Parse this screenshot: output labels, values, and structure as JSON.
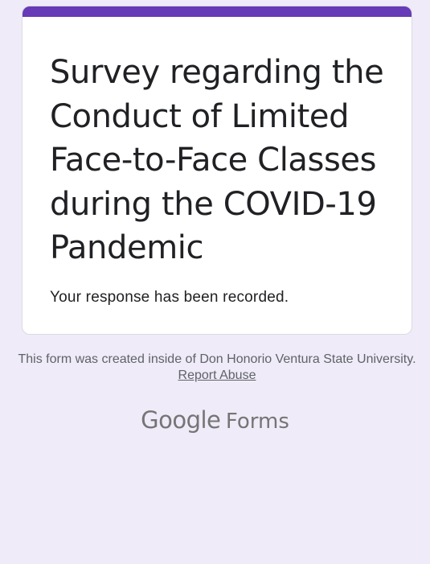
{
  "colors": {
    "background": "#efebf8",
    "accent": "#673ab7",
    "card": "#ffffff",
    "text_primary": "#202124",
    "text_secondary": "#5f6368",
    "brand_text": "#757575"
  },
  "form": {
    "title": "Survey regarding the Conduct of Limited Face-to-Face Classes during the COVID-19 Pandemic",
    "confirmation_message": "Your response has been recorded."
  },
  "footer": {
    "created_text": "This form was created inside of Don Honorio Ventura State University.",
    "report_abuse_label": "Report Abuse"
  },
  "branding": {
    "google": "Google",
    "forms": "Forms"
  }
}
